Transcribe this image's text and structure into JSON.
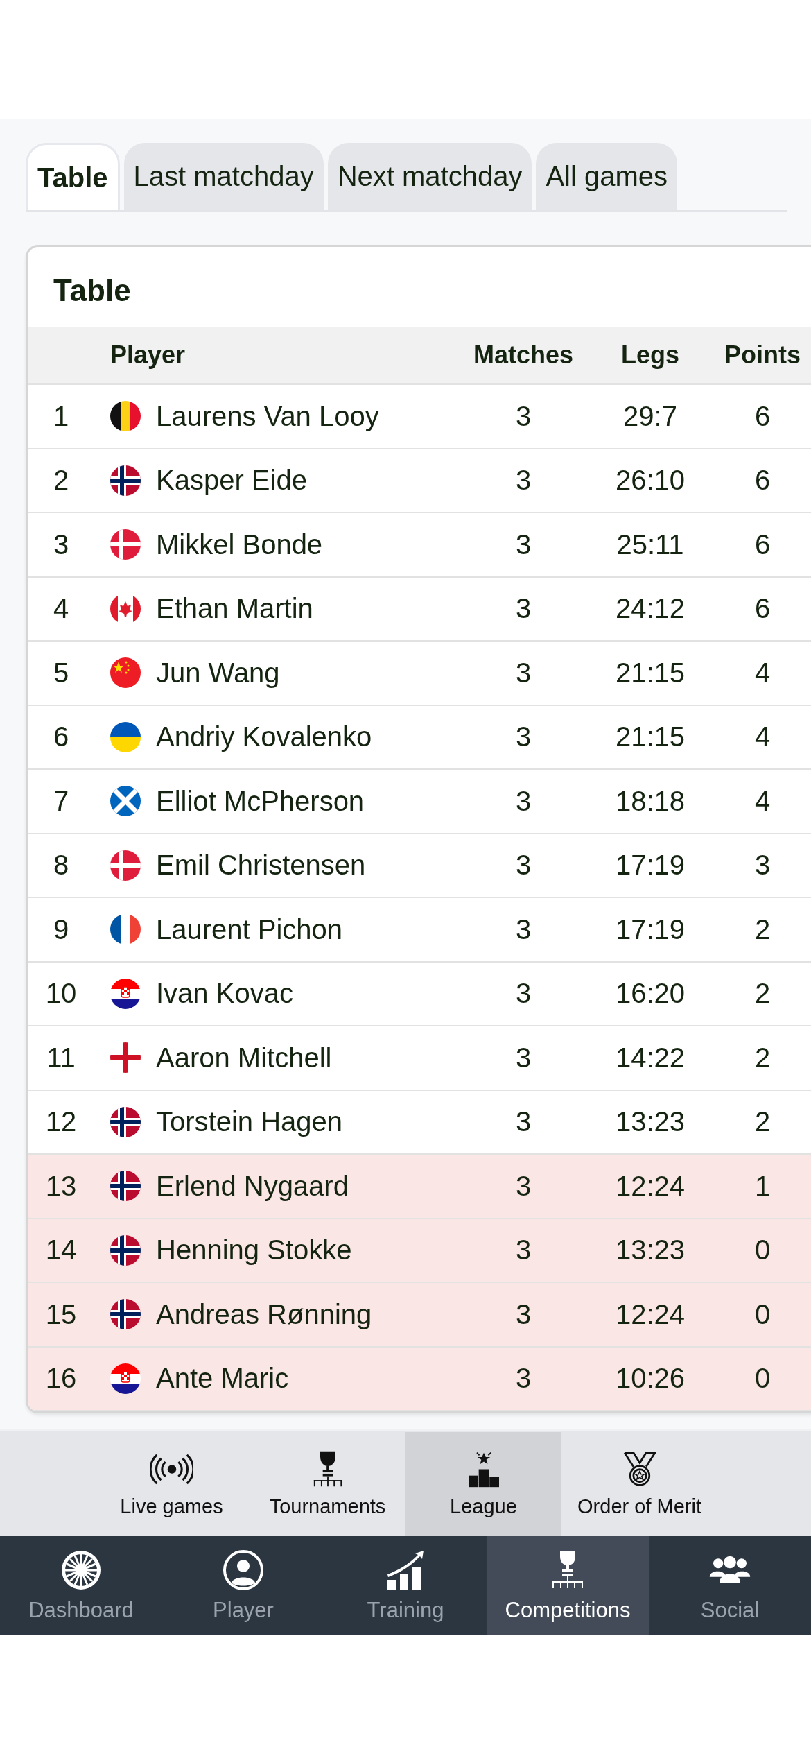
{
  "tabs": [
    {
      "label": "Table",
      "selected": true
    },
    {
      "label": "Last matchday",
      "selected": false
    },
    {
      "label": "Next matchday",
      "selected": false
    },
    {
      "label": "All games",
      "selected": false
    }
  ],
  "card": {
    "title": "Table",
    "columns": [
      "Player",
      "Matches",
      "Legs",
      "Points"
    ],
    "rows": [
      {
        "rank": "1",
        "kind": "be",
        "player": "Laurens Van Looy",
        "matches": "3",
        "legs": "29:7",
        "points": "6",
        "highlighted": false
      },
      {
        "rank": "2",
        "kind": "no",
        "player": "Kasper Eide",
        "matches": "3",
        "legs": "26:10",
        "points": "6",
        "highlighted": false
      },
      {
        "rank": "3",
        "kind": "dk",
        "player": "Mikkel Bonde",
        "matches": "3",
        "legs": "25:11",
        "points": "6",
        "highlighted": false
      },
      {
        "rank": "4",
        "kind": "ca",
        "player": "Ethan Martin",
        "matches": "3",
        "legs": "24:12",
        "points": "6",
        "highlighted": false
      },
      {
        "rank": "5",
        "kind": "cn",
        "player": "Jun Wang",
        "matches": "3",
        "legs": "21:15",
        "points": "4",
        "highlighted": false
      },
      {
        "rank": "6",
        "kind": "ua",
        "player": "Andriy Kovalenko",
        "matches": "3",
        "legs": "21:15",
        "points": "4",
        "highlighted": false
      },
      {
        "rank": "7",
        "kind": "sc",
        "player": "Elliot McPherson",
        "matches": "3",
        "legs": "18:18",
        "points": "4",
        "highlighted": false
      },
      {
        "rank": "8",
        "kind": "dk",
        "player": "Emil Christensen",
        "matches": "3",
        "legs": "17:19",
        "points": "3",
        "highlighted": false
      },
      {
        "rank": "9",
        "kind": "fr",
        "player": "Laurent Pichon",
        "matches": "3",
        "legs": "17:19",
        "points": "2",
        "highlighted": false
      },
      {
        "rank": "10",
        "kind": "hr",
        "player": "Ivan Kovac",
        "matches": "3",
        "legs": "16:20",
        "points": "2",
        "highlighted": false
      },
      {
        "rank": "11",
        "kind": "en",
        "player": "Aaron Mitchell",
        "matches": "3",
        "legs": "14:22",
        "points": "2",
        "highlighted": false
      },
      {
        "rank": "12",
        "kind": "no",
        "player": "Torstein Hagen",
        "matches": "3",
        "legs": "13:23",
        "points": "2",
        "highlighted": false
      },
      {
        "rank": "13",
        "kind": "no",
        "player": "Erlend Nygaard",
        "matches": "3",
        "legs": "12:24",
        "points": "1",
        "highlighted": true
      },
      {
        "rank": "14",
        "kind": "no",
        "player": "Henning Stokke",
        "matches": "3",
        "legs": "13:23",
        "points": "0",
        "highlighted": true
      },
      {
        "rank": "15",
        "kind": "no",
        "player": "Andreas Rønning",
        "matches": "3",
        "legs": "12:24",
        "points": "0",
        "highlighted": true
      },
      {
        "rank": "16",
        "kind": "hr",
        "player": "Ante Maric",
        "matches": "3",
        "legs": "10:26",
        "points": "0",
        "highlighted": true
      }
    ]
  },
  "sub_nav": [
    {
      "kind": "live",
      "label": "Live games",
      "selected": false
    },
    {
      "kind": "tournaments",
      "label": "Tournaments",
      "selected": false
    },
    {
      "kind": "league",
      "label": "League",
      "selected": true
    },
    {
      "kind": "merit",
      "label": "Order of Merit",
      "selected": false
    }
  ],
  "main_nav": [
    {
      "kind": "dashboard",
      "label": "Dashboard",
      "selected": false
    },
    {
      "kind": "player",
      "label": "Player",
      "selected": false
    },
    {
      "kind": "training",
      "label": "Training",
      "selected": false
    },
    {
      "kind": "competitions",
      "label": "Competitions",
      "selected": true
    },
    {
      "kind": "social",
      "label": "Social",
      "selected": false
    }
  ]
}
